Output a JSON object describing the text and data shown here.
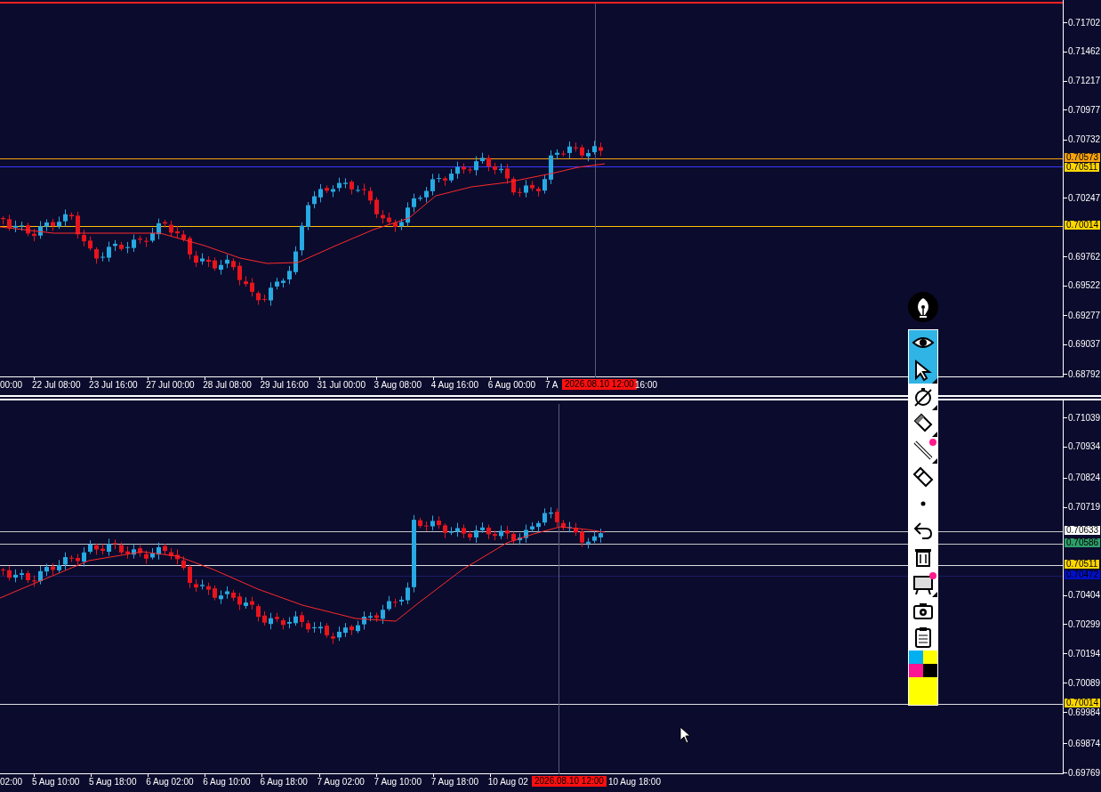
{
  "panels": [
    {
      "price_labels": [
        "0.71702",
        "0.71462",
        "0.71217",
        "0.70977",
        "0.70732",
        "0.70247",
        "0.69762",
        "0.69522",
        "0.69277",
        "0.69037",
        "0.68792"
      ],
      "price_tags": [
        {
          "text": "0.70573",
          "color": "#f7a30c",
          "line": {
            "color": "#f7a30c"
          }
        },
        {
          "text": "0.70511",
          "color": "#ffd700",
          "line": {
            "color": "#3a3aff"
          }
        },
        {
          "text": "0.70014",
          "color": "#ffd700",
          "line": {
            "color": "#ffc000"
          }
        }
      ],
      "time_labels": [
        "00:00",
        "22 Jul 08:00",
        "23 Jul 16:00",
        "27 Jul 00:00",
        "28 Jul 08:00",
        "29 Jul 16:00",
        "31 Jul 00:00",
        "3 Aug 08:00",
        "4 Aug 16:00",
        "6 Aug 00:00",
        "7 A"
      ],
      "crosshair_time": "2026.08.10 12:00",
      "time_labels_after": [
        "16:00"
      ]
    },
    {
      "price_labels": [
        "0.71039",
        "0.70934",
        "0.70824",
        "0.70719",
        "0.70404",
        "0.70299",
        "0.70194",
        "0.70089",
        "0.69984",
        "0.69874",
        "0.69769"
      ],
      "price_tags": [
        {
          "text": "0.70633",
          "color": "#ffffff",
          "line": {
            "color": "#c8c8c8"
          }
        },
        {
          "text": "0.70586",
          "color": "#2e9e6a",
          "line": {
            "color": "#c8c8c8"
          }
        },
        {
          "text": "0.70511",
          "color": "#ffd700",
          "line": {
            "color": "#e0e0e0"
          }
        },
        {
          "text": "0.70472",
          "color": "#0010c8",
          "line": {
            "color": "#1a1a6a"
          }
        },
        {
          "text": "0.70014",
          "color": "#ffd700",
          "line": {
            "color": "#e0e0e0"
          }
        }
      ],
      "time_labels": [
        "02:00",
        "5 Aug 10:00",
        "5 Aug 18:00",
        "6 Aug 02:00",
        "6 Aug 10:00",
        "6 Aug 18:00",
        "7 Aug 02:00",
        "7 Aug 10:00",
        "7 Aug 18:00",
        "10 Aug 02"
      ],
      "crosshair_time": "2026.08.10 12:00",
      "time_labels_after": [
        "10 Aug 18:00"
      ]
    }
  ],
  "toolbar": {
    "tools": [
      {
        "kind": "eye",
        "selected": true,
        "has_menu": false,
        "badge": false
      },
      {
        "kind": "cursor",
        "selected": true,
        "has_menu": true,
        "badge": false
      },
      {
        "kind": "stopwatch",
        "selected": false,
        "has_menu": true,
        "badge": false
      },
      {
        "kind": "pencil",
        "selected": false,
        "has_menu": true,
        "badge": false
      },
      {
        "kind": "line",
        "selected": false,
        "has_menu": true,
        "badge": true
      },
      {
        "kind": "eraser",
        "selected": false,
        "has_menu": false,
        "badge": false
      },
      {
        "kind": "dot",
        "selected": false,
        "has_menu": false,
        "badge": false
      },
      {
        "kind": "undo",
        "selected": false,
        "has_menu": false,
        "badge": false
      },
      {
        "kind": "trash",
        "selected": false,
        "has_menu": false,
        "badge": false
      },
      {
        "kind": "easel",
        "selected": false,
        "has_menu": true,
        "badge": true
      },
      {
        "kind": "camera",
        "selected": false,
        "has_menu": false,
        "badge": false
      },
      {
        "kind": "clipboard",
        "selected": false,
        "has_menu": false,
        "badge": false
      }
    ],
    "palette": [
      {
        "color": "#00b0f0"
      },
      {
        "color": "#ffff00"
      },
      {
        "color": "#ff1493"
      },
      {
        "color": "#000000"
      },
      {
        "color": "#ffff00"
      }
    ]
  }
}
